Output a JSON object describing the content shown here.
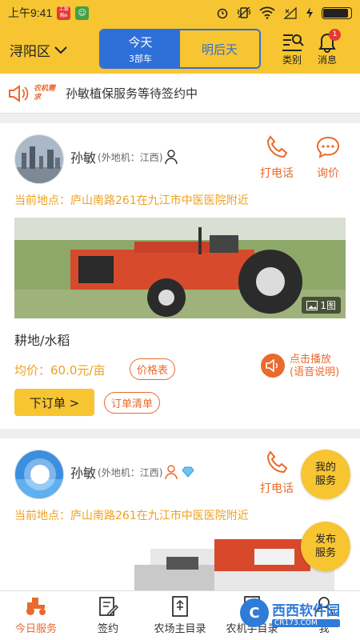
{
  "status_bar": {
    "time": "上午9:41",
    "badge_1": "工银融e",
    "badge_2": "☺"
  },
  "header": {
    "district": "浔阳区",
    "segment": [
      {
        "label": "今天",
        "sub": "3部车"
      },
      {
        "label": "明后天",
        "sub": ""
      }
    ],
    "category_label": "类别",
    "message_label": "消息",
    "message_count": "1"
  },
  "notice": {
    "tag": "农机需求",
    "text": "孙敏植保服务等待签约中"
  },
  "cards": [
    {
      "name": "孙敏",
      "origin": "(外地机：江西)",
      "call_label": "打电话",
      "inquire_label": "询价",
      "location": "当前地点：庐山南路261在九江市中医医院附近",
      "photo_count": "1图",
      "service": "耕地/水稻",
      "price": "均价：60.0元/亩",
      "price_list_label": "价格表",
      "audio_label_1": "点击播放",
      "audio_label_2": "(语音说明)",
      "order_label": "下订单 >",
      "order_list_label": "订单清单"
    },
    {
      "name": "孙敏",
      "origin": "(外地机：江西)",
      "call_label": "打电话",
      "location": "当前地点：庐山南路261在九江市中医医院附近"
    }
  ],
  "fab": {
    "my_service": [
      "我的",
      "服务"
    ],
    "publish_service": [
      "发布",
      "服务"
    ]
  },
  "bottom_nav": [
    {
      "label": "今日服务",
      "icon": "tractor-icon"
    },
    {
      "label": "签约",
      "icon": "sign-icon"
    },
    {
      "label": "农场主目录",
      "icon": "directory-icon"
    },
    {
      "label": "农机手目录",
      "icon": "operator-icon"
    },
    {
      "label": "我",
      "icon": "user-icon"
    }
  ],
  "watermark": {
    "logo": "C",
    "main": "西西软件园",
    "sub": "CR173.COM"
  },
  "colors": {
    "yellow": "#f7c531",
    "blue": "#2f6fd8",
    "orange": "#e96a2d",
    "gold_text": "#f0a020"
  }
}
